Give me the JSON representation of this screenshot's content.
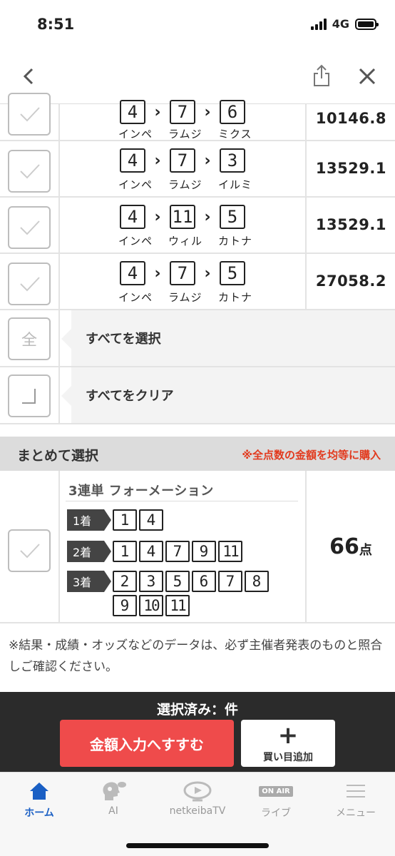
{
  "status_bar": {
    "time": "8:51",
    "network": "4G"
  },
  "bets": [
    {
      "nums": [
        "4",
        "7",
        "6"
      ],
      "names": [
        "インペ",
        "ラムジ",
        "ミクス"
      ],
      "odds": "10146.8"
    },
    {
      "nums": [
        "4",
        "7",
        "3"
      ],
      "names": [
        "インペ",
        "ラムジ",
        "イルミ"
      ],
      "odds": "13529.1"
    },
    {
      "nums": [
        "4",
        "11",
        "5"
      ],
      "names": [
        "インペ",
        "ウィル",
        "カトナ"
      ],
      "odds": "13529.1"
    },
    {
      "nums": [
        "4",
        "7",
        "5"
      ],
      "names": [
        "インペ",
        "ラムジ",
        "カトナ"
      ],
      "odds": "27058.2"
    }
  ],
  "select_all": {
    "glyph": "全",
    "label": "すべてを選択"
  },
  "clear_all": {
    "label": "すべてをクリア"
  },
  "bulk": {
    "title": "まとめて選択",
    "note": "※全点数の金額を均等に購入"
  },
  "formation": {
    "title": "3連単 フォーメーション",
    "places": [
      {
        "label": "1着",
        "nums": [
          "1",
          "4"
        ]
      },
      {
        "label": "2着",
        "nums": [
          "1",
          "4",
          "7",
          "9",
          "11"
        ]
      },
      {
        "label": "3着",
        "nums": [
          "2",
          "3",
          "5",
          "6",
          "7",
          "8",
          "9",
          "10",
          "11"
        ]
      }
    ],
    "points": "66",
    "points_unit": "点"
  },
  "disclaimer": "※結果・成績・オッズなどのデータは、必ず主催者発表のものと照合しご確認ください。",
  "action_bar": {
    "selected_text": "選択済み：件",
    "proceed_label": "金額入力へすすむ",
    "add_plus": "+",
    "add_label": "買い目追加"
  },
  "tabs": [
    {
      "label": "ホーム",
      "icon": "home-icon",
      "active": true
    },
    {
      "label": "AI",
      "icon": "ai-head-icon",
      "active": false
    },
    {
      "label": "netkeibaTV",
      "icon": "tv-play-icon",
      "active": false
    },
    {
      "label": "ライブ",
      "icon": "on-air-icon",
      "badge": "ON AIR",
      "active": false
    },
    {
      "label": "メニュー",
      "icon": "menu-icon",
      "active": false
    }
  ],
  "colors": {
    "accent_red": "#ef4b4b",
    "note_red": "#e23a1e",
    "active_tab": "#1a5fc4",
    "dark_bar": "#2b2b2b"
  }
}
